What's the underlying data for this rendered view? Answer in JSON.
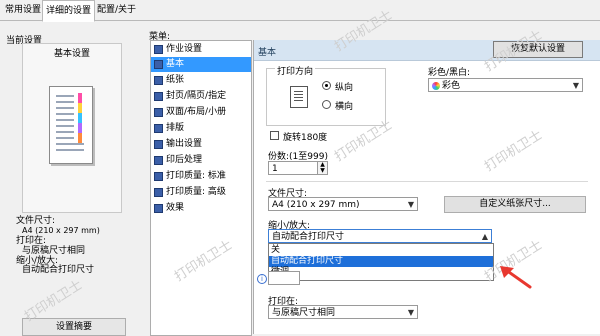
{
  "tabs": [
    {
      "label": "常用设置"
    },
    {
      "label": "详细的设置"
    },
    {
      "label": "配置/关于"
    }
  ],
  "left_panel": {
    "current_settings_label": "当前设置",
    "preview_title": "基本设置",
    "info": {
      "paper_size_label": "文件尺寸:",
      "paper_size_value": "A4 (210 x 297 mm)",
      "print_on_label": "打印在:",
      "print_on_value": "与原稿尺寸相同",
      "zoom_label": "缩小/放大:",
      "zoom_value": "自动配合打印尺寸"
    },
    "summary_button": "设置摘要"
  },
  "menu": {
    "label": "菜单:",
    "items": [
      {
        "label": "作业设置",
        "icon": "job-icon"
      },
      {
        "label": "基本",
        "icon": "basic-icon",
        "selected": true
      },
      {
        "label": "纸张",
        "icon": "paper-icon"
      },
      {
        "label": "封页/隔页/指定",
        "icon": "cover-icon"
      },
      {
        "label": "双面/布局/小册",
        "icon": "duplex-icon"
      },
      {
        "label": "排版",
        "icon": "layout-icon"
      },
      {
        "label": "输出设置",
        "icon": "output-icon"
      },
      {
        "label": "印后处理",
        "icon": "finishing-icon"
      },
      {
        "label": "打印质量: 标准",
        "icon": "quality-standard-icon"
      },
      {
        "label": "打印质量: 高级",
        "icon": "quality-advanced-icon"
      },
      {
        "label": "效果",
        "icon": "effects-icon"
      }
    ]
  },
  "content": {
    "header_title": "基本",
    "restore_defaults": "恢复默认设置",
    "orientation": {
      "label": "打印方向",
      "portrait": "纵向",
      "landscape": "横向",
      "selected": "portrait"
    },
    "color_mode": {
      "label": "彩色/黑白:",
      "value": "彩色"
    },
    "rotate_180": "旋转180度",
    "copies": {
      "label": "份数:(1至999)",
      "value": "1"
    },
    "paper_size": {
      "label": "文件尺寸:",
      "value": "A4 (210 x 297 mm)"
    },
    "custom_size_button": "自定义纸张尺寸...",
    "zoom": {
      "label": "缩小/放大:",
      "value": "自动配合打印尺寸",
      "options": [
        "关",
        "自动配合打印尺寸",
        "微调"
      ],
      "highlighted_index": 1
    },
    "print_on": {
      "label": "打印在:",
      "value": "与原稿尺寸相同"
    }
  },
  "watermark": "打印机卫士",
  "colors": {
    "selection": "#3399ff",
    "dropdown_highlight": "#1e6fd9",
    "header_bg": "#d6e4f2",
    "annotation_arrow": "#e8382f"
  }
}
